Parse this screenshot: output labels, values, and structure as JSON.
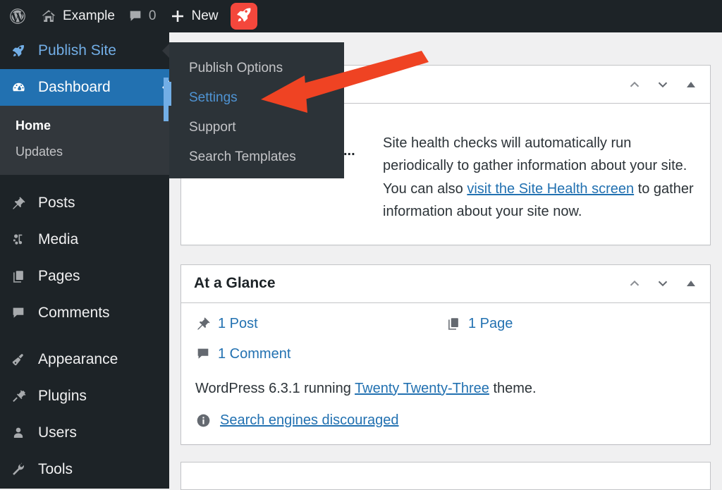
{
  "adminbar": {
    "wp_logo_icon": "wordpress-logo-icon",
    "site_icon": "home-icon",
    "site_name": "Example",
    "comments_icon": "comment-bubble-icon",
    "comments_count": "0",
    "new_icon": "plus-icon",
    "new_label": "New",
    "rocket_icon": "rocket-icon",
    "rocket_color": "#f4473c"
  },
  "sidebar": {
    "publish_site": {
      "label": "Publish Site",
      "icon": "rocket-icon"
    },
    "dashboard": {
      "label": "Dashboard",
      "icon": "dashboard-gauge-icon"
    },
    "submenu": [
      {
        "label": "Home",
        "current": true
      },
      {
        "label": "Updates",
        "current": false
      }
    ],
    "items": [
      {
        "label": "Posts",
        "icon": "pin-icon"
      },
      {
        "label": "Media",
        "icon": "media-icon"
      },
      {
        "label": "Pages",
        "icon": "pages-icon"
      },
      {
        "label": "Comments",
        "icon": "comment-bubble-icon"
      },
      {
        "label": "Appearance",
        "icon": "paintbrush-icon"
      },
      {
        "label": "Plugins",
        "icon": "plug-icon"
      },
      {
        "label": "Users",
        "icon": "user-icon"
      },
      {
        "label": "Tools",
        "icon": "wrench-icon"
      }
    ],
    "accent_color": "#2271b1"
  },
  "flyout": {
    "items": [
      {
        "label": "Publish Options",
        "active": false
      },
      {
        "label": "Settings",
        "active": true
      },
      {
        "label": "Support",
        "active": false
      },
      {
        "label": "Search Templates",
        "active": false
      }
    ],
    "active_color": "#4f94d4"
  },
  "site_health": {
    "title": "",
    "buttons": [
      {
        "icon": "chevron-up-icon"
      },
      {
        "icon": "chevron-down-icon"
      },
      {
        "icon": "triangle-up-toggle-icon"
      }
    ],
    "status_text": "No information yet...",
    "description_before": "Site health checks will automatically run periodically to gather information about your site. You can also ",
    "link_text": "visit the Site Health screen",
    "description_after": " to gather information about your site now."
  },
  "at_a_glance": {
    "title": "At a Glance",
    "buttons": [
      {
        "icon": "chevron-up-icon"
      },
      {
        "icon": "chevron-down-icon"
      },
      {
        "icon": "triangle-up-toggle-icon"
      }
    ],
    "counts": [
      {
        "icon": "pin-icon",
        "label": "1 Post"
      },
      {
        "icon": "pages-icon",
        "label": "1 Page"
      },
      {
        "icon": "comment-bubble-icon",
        "label": "1 Comment"
      }
    ],
    "version_prefix": "WordPress 6.3.1 running ",
    "theme_name": "Twenty Twenty-Three",
    "version_suffix": " theme.",
    "seo_icon": "info-icon",
    "seo_label": "Search engines discouraged"
  },
  "annotation": {
    "arrow_color": "#ef4323",
    "arrow_name": "red-pointer-arrow"
  }
}
